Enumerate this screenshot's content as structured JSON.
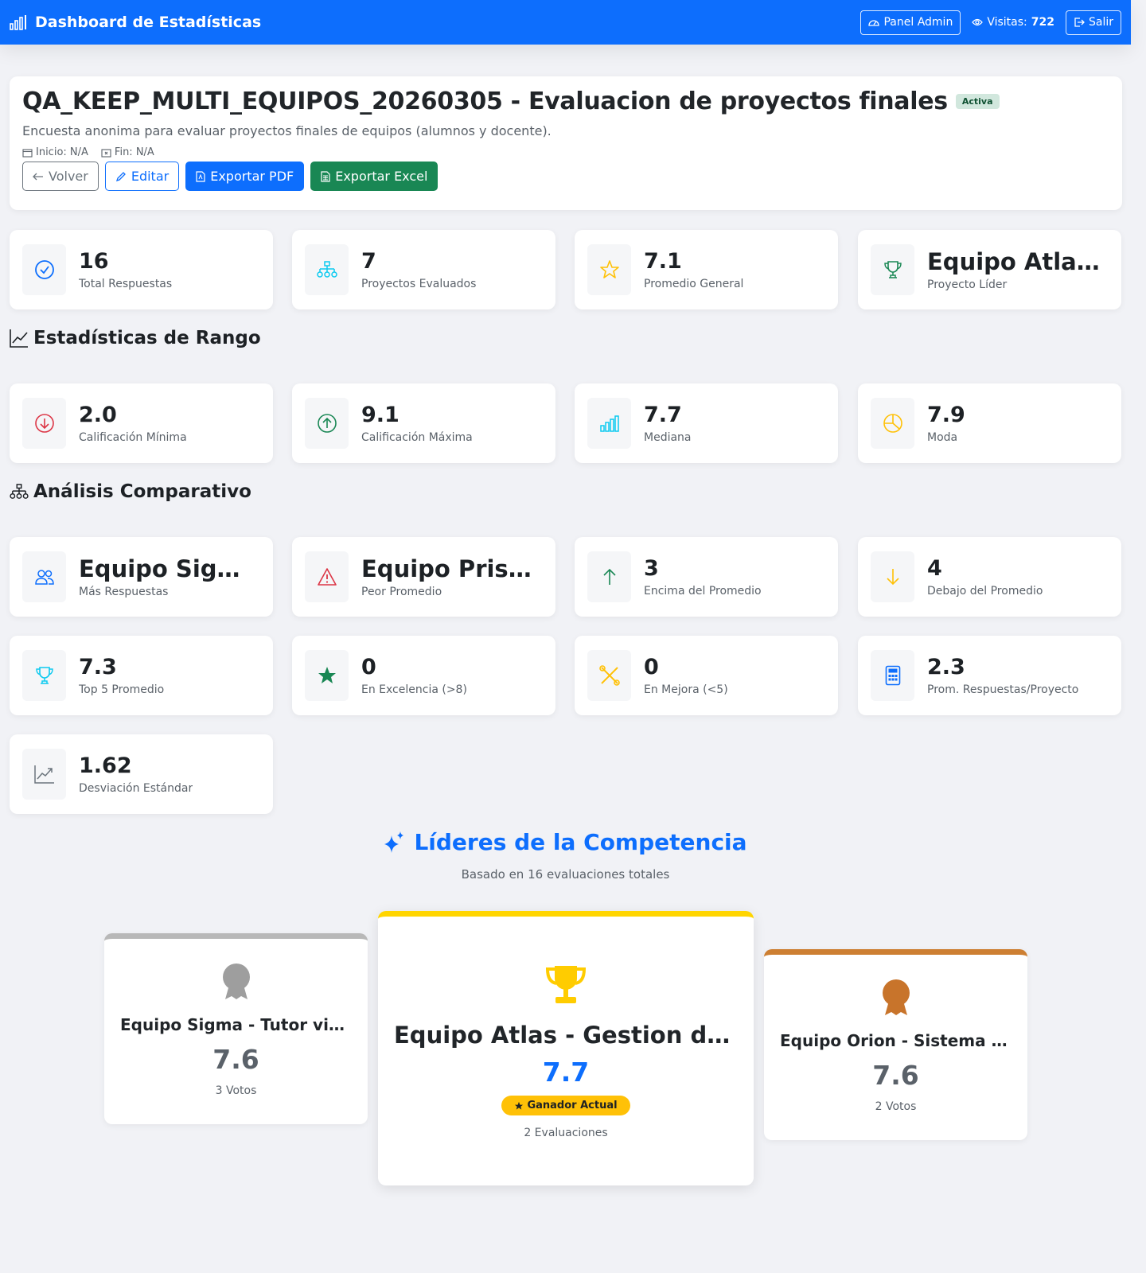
{
  "navbar": {
    "brand": "Dashboard de Estadísticas",
    "admin_label": "Panel Admin",
    "visits_label": "Visitas:",
    "visits_value": "722",
    "logout_label": "Salir"
  },
  "survey": {
    "title": "QA_KEEP_MULTI_EQUIPOS_20260305 - Evaluacion de proyectos finales",
    "status": "Activa",
    "description": "Encuesta anonima para evaluar proyectos finales de equipos (alumnos y docente).",
    "start_label": "Inicio: N/A",
    "end_label": "Fin: N/A",
    "actions": {
      "back": "Volver",
      "edit": "Editar",
      "export_pdf": "Exportar PDF",
      "export_excel": "Exportar Excel"
    }
  },
  "summary": [
    {
      "value": "16",
      "label": "Total Respuestas",
      "icon": "check-circle-icon",
      "color": "#0d6efd"
    },
    {
      "value": "7",
      "label": "Proyectos Evaluados",
      "icon": "diagram-icon",
      "color": "#0dcaf0"
    },
    {
      "value": "7.1",
      "label": "Promedio General",
      "icon": "star-icon",
      "color": "#ffc107"
    },
    {
      "value": "Equipo Atlas - Gestion",
      "label": "Proyecto Líder",
      "icon": "trophy-icon",
      "color": "#198754"
    }
  ],
  "range": {
    "title": "Estadísticas de Rango",
    "items": [
      {
        "value": "2.0",
        "label": "Calificación Mínima",
        "icon": "arrow-down-circle-icon",
        "color": "#dc3545"
      },
      {
        "value": "9.1",
        "label": "Calificación Máxima",
        "icon": "arrow-up-circle-icon",
        "color": "#198754"
      },
      {
        "value": "7.7",
        "label": "Mediana",
        "icon": "bar-chart-icon",
        "color": "#0dcaf0"
      },
      {
        "value": "7.9",
        "label": "Moda",
        "icon": "pie-chart-icon",
        "color": "#ffc107"
      }
    ]
  },
  "comparative": {
    "title": "Análisis Comparativo",
    "items": [
      {
        "value": "Equipo Sigma - Tutor virtual",
        "label": "Más Respuestas",
        "icon": "people-icon",
        "color": "#0d6efd"
      },
      {
        "value": "Equipo Prism - Plataforma",
        "label": "Peor Promedio",
        "icon": "warning-icon",
        "color": "#dc3545"
      },
      {
        "value": "3",
        "label": "Encima del Promedio",
        "icon": "arrow-up-icon",
        "color": "#198754"
      },
      {
        "value": "4",
        "label": "Debajo del Promedio",
        "icon": "arrow-down-icon",
        "color": "#ffc107"
      },
      {
        "value": "7.3",
        "label": "Top 5 Promedio",
        "icon": "trophy-icon",
        "color": "#0dcaf0"
      },
      {
        "value": "0",
        "label": "En Excelencia (>8)",
        "icon": "star-filled-icon",
        "color": "#198754"
      },
      {
        "value": "0",
        "label": "En Mejora (<5)",
        "icon": "tools-icon",
        "color": "#ffc107"
      },
      {
        "value": "2.3",
        "label": "Prom. Respuestas/Proyecto",
        "icon": "calculator-icon",
        "color": "#0d6efd"
      },
      {
        "value": "1.62",
        "label": "Desviación Estándar",
        "icon": "graph-up-icon",
        "color": "#6c757d"
      }
    ]
  },
  "leaders": {
    "title": "Líderes de la Competencia",
    "subtitle": "Basado en 16 evaluaciones totales",
    "first": {
      "name": "Equipo Atlas - Gestion de inventario",
      "score": "7.7",
      "badge": "Ganador Actual",
      "votes": "2 Evaluaciones"
    },
    "second": {
      "name": "Equipo Sigma - Tutor virtual",
      "score": "7.6",
      "votes": "3 Votos"
    },
    "third": {
      "name": "Equipo Orion - Sistema de reservas",
      "score": "7.6",
      "votes": "2 Votos"
    }
  }
}
